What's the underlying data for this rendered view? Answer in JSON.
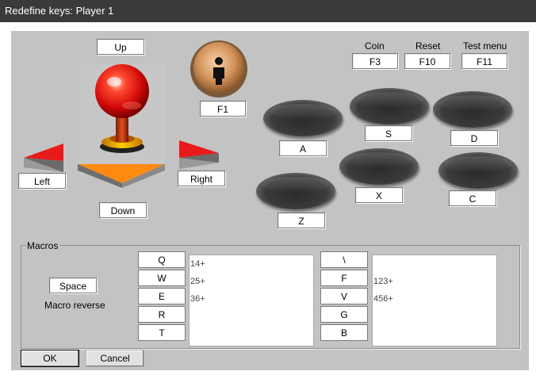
{
  "window": {
    "title": "Redefine keys: Player 1"
  },
  "joystick": {
    "up": "Up",
    "down": "Down",
    "left": "Left",
    "right": "Right"
  },
  "start": {
    "key": "F1"
  },
  "system": {
    "coin_label": "Coin",
    "coin_key": "F3",
    "reset_label": "Reset",
    "reset_key": "F10",
    "test_label": "Test menu",
    "test_key": "F11"
  },
  "buttons": {
    "a": "A",
    "s": "S",
    "d": "D",
    "z": "Z",
    "x": "X",
    "c": "C"
  },
  "macros": {
    "legend": "Macros",
    "trigger_key": "Space",
    "reverse_label": "Macro reverse",
    "left_keys": [
      "Q",
      "W",
      "E",
      "R",
      "T"
    ],
    "left_values": [
      "14+",
      "25+",
      "36+"
    ],
    "right_keys": [
      "\\",
      "F",
      "V",
      "G",
      "B"
    ],
    "right_values": [
      "",
      "123+",
      "456+"
    ]
  },
  "footer": {
    "ok": "OK",
    "cancel": "Cancel"
  },
  "colors": {
    "titlebar": "#3a3a3a",
    "dialog": "#c3c3c3",
    "ball": "#e01010",
    "arrow": "#e02020"
  }
}
